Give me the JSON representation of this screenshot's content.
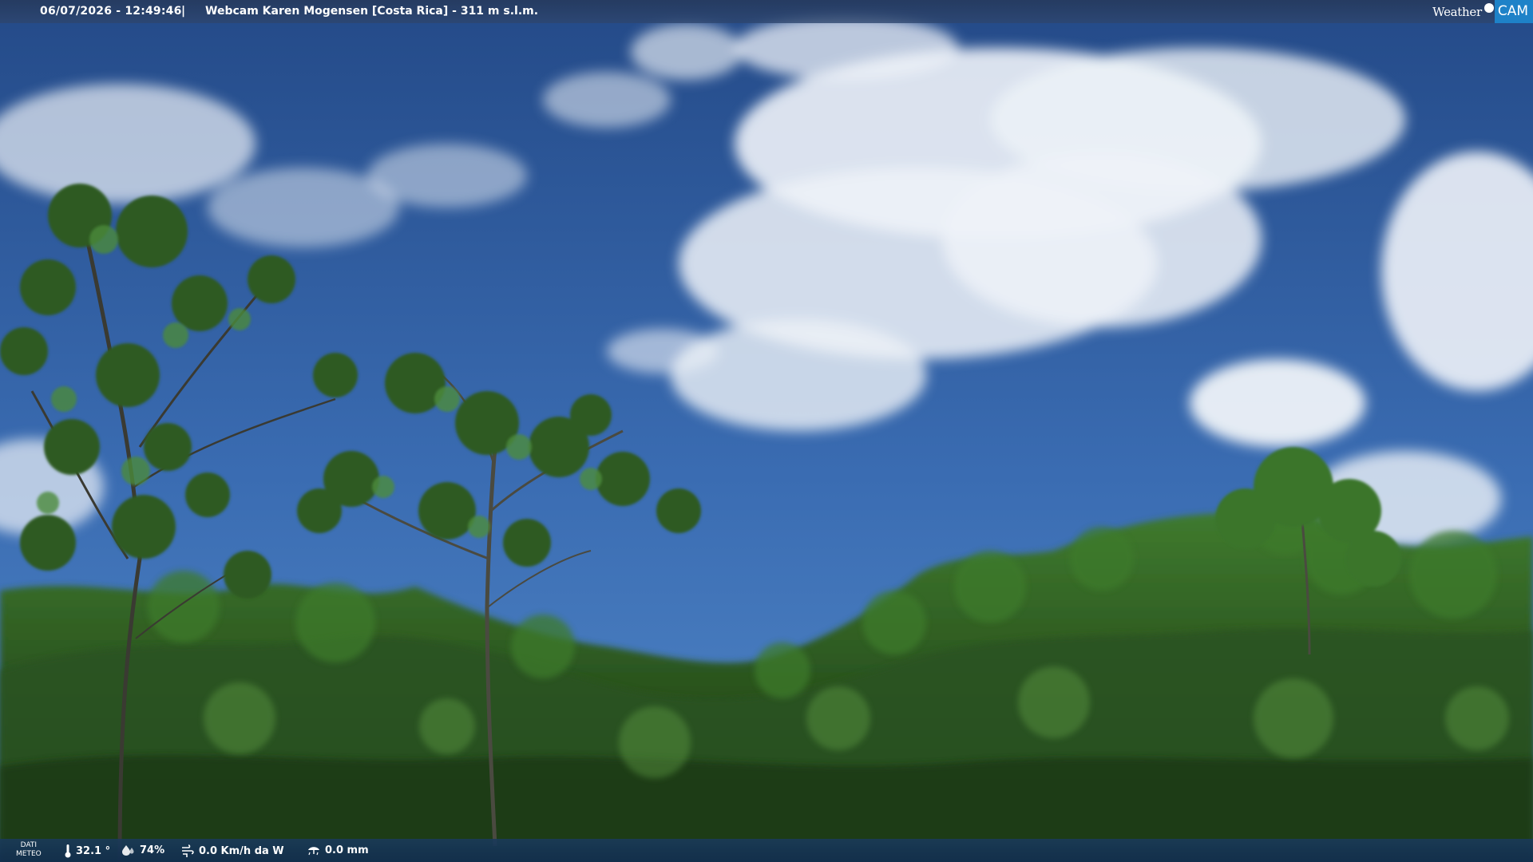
{
  "header": {
    "datetime": "06/07/2026 - 12:49:46",
    "separator": "|",
    "title": "Webcam Karen Mogensen [Costa Rica]  - 311 m s.l.m."
  },
  "logo": {
    "weather": "Weather",
    "cam": "CAM"
  },
  "footer": {
    "dati": "DATI",
    "meteo": "METEO",
    "temperature": "32.1 °",
    "humidity": "74%",
    "wind": "0.0 Km/h da W",
    "rain": "0.0 mm"
  },
  "icons": {
    "temperature": "thermometer-icon",
    "humidity": "humidity-icon",
    "wind": "wind-icon",
    "rain": "rain-icon"
  },
  "colors": {
    "sky_top": "#274f8e",
    "sky_bottom": "#4a7bbf",
    "forest_dark": "#1c3814",
    "forest_mid": "#2f5a22",
    "forest_light": "#4f8a38",
    "logo_cam": "#1e82c8"
  }
}
